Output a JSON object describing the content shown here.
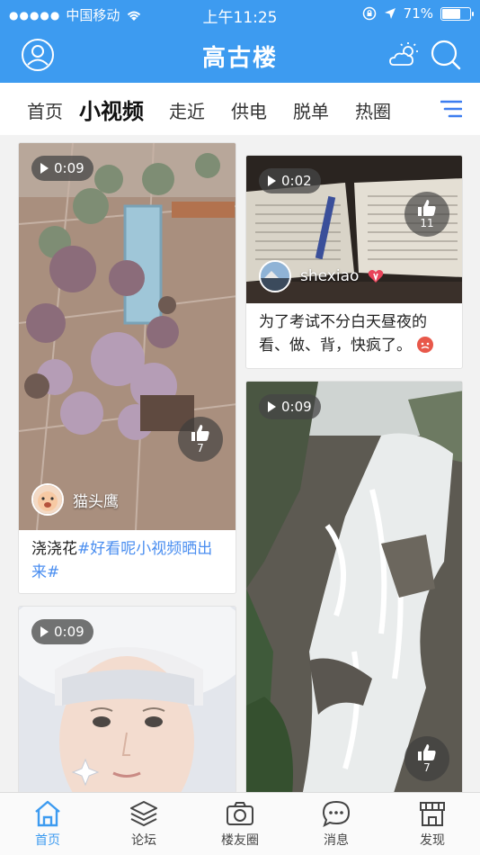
{
  "status_bar": {
    "signal": "●●●●●",
    "carrier": "中国移动",
    "time": "上午11:25",
    "battery": "71%",
    "battery_level": 0.71
  },
  "header": {
    "title": "高古楼",
    "profile_icon": "user-icon",
    "weather_icon": "cloud-sun-icon",
    "search_icon": "search-icon",
    "bg_color": "#3d9bf0"
  },
  "channels": {
    "tabs": [
      {
        "label": "首页"
      },
      {
        "label": "小视频",
        "active": true
      },
      {
        "label": "走近"
      },
      {
        "label": "供电"
      },
      {
        "label": "脱单"
      },
      {
        "label": "热圈"
      }
    ],
    "menu_icon": "menu-lines-icon"
  },
  "feed": {
    "cards": [
      {
        "duration": "0:09",
        "likes": "7",
        "author": "猫头鹰",
        "caption_plain": "浇浇花",
        "caption_tag": "#好看呢小视频晒出来#"
      },
      {
        "duration": "0:02",
        "likes": "11",
        "author": "shexiao",
        "caption_plain": "为了考试不分白天昼夜的看、做、背，快疯了。"
      },
      {
        "duration": "0:09",
        "likes": "7"
      },
      {
        "duration": "0:09"
      }
    ]
  },
  "tabbar": {
    "items": [
      {
        "label": "首页",
        "icon": "home-icon",
        "active": true
      },
      {
        "label": "论坛",
        "icon": "layers-icon"
      },
      {
        "label": "楼友圈",
        "icon": "camera-icon"
      },
      {
        "label": "消息",
        "icon": "chat-bubble-icon"
      },
      {
        "label": "发现",
        "icon": "store-icon"
      }
    ],
    "active_color": "#3d9bf0"
  }
}
